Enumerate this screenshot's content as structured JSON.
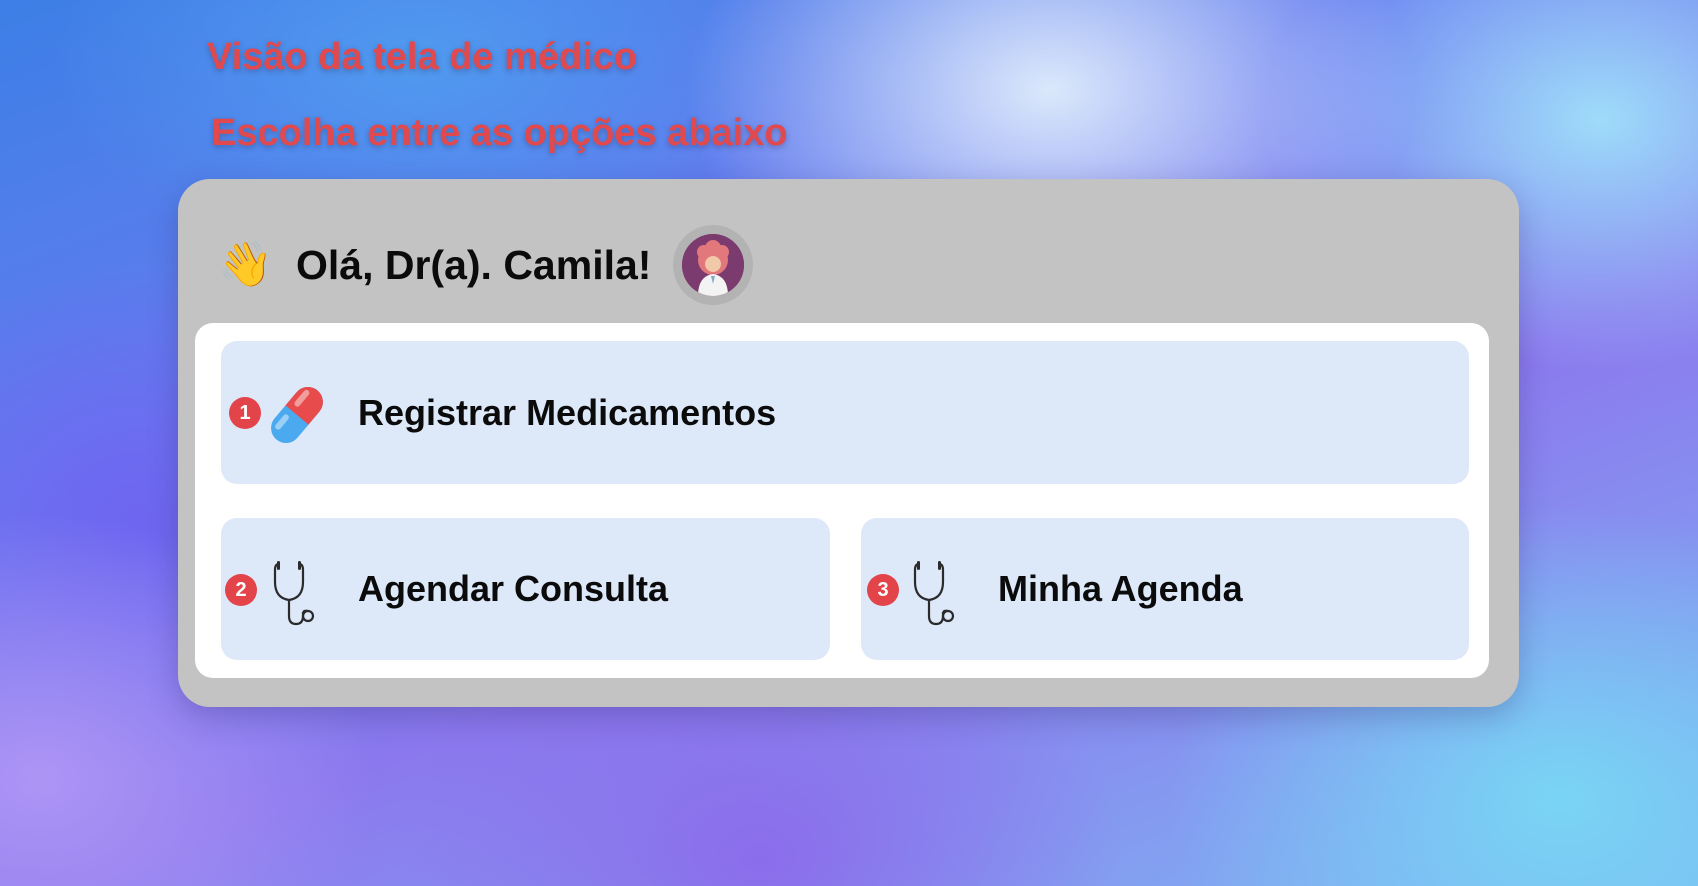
{
  "page": {
    "title": "Visão da tela de médico",
    "subtitle": "Escolha entre as opções abaixo"
  },
  "header": {
    "wave_icon": "waving-hand-emoji",
    "greeting": "Olá, Dr(a). Camila!",
    "avatar_icon": "doctor-avatar"
  },
  "options": [
    {
      "number": "1",
      "icon": "pill-capsule-icon",
      "label": "Registrar Medicamentos"
    },
    {
      "number": "2",
      "icon": "stethoscope-icon",
      "label": "Agendar Consulta"
    },
    {
      "number": "3",
      "icon": "stethoscope-icon",
      "label": "Minha Agenda"
    }
  ],
  "colors": {
    "heading": "#e04a4f",
    "card_bg": "#c3c3c3",
    "option_bg": "#dde8f9",
    "badge": "#e2444a"
  }
}
